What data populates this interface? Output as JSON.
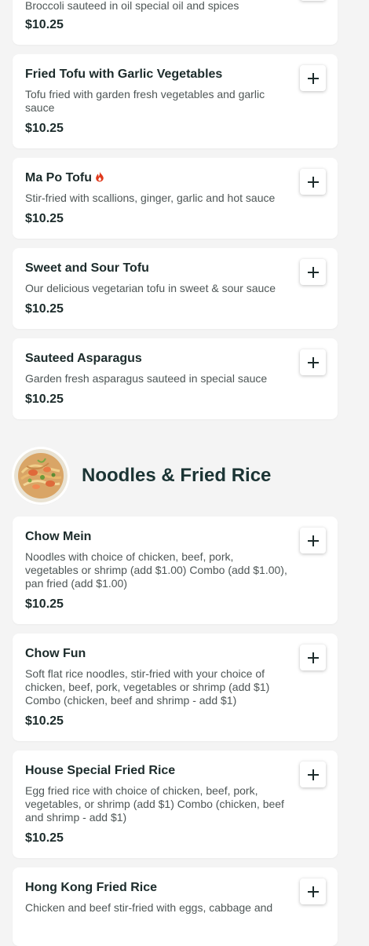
{
  "colors": {
    "background": "#f4f4f4",
    "card": "#ffffff",
    "title_text": "#1c2b2b",
    "desc_text": "#4e5656",
    "spicy": "#e0391c"
  },
  "partial_item": {
    "desc": "Broccoli sauteed in oil special oil and spices",
    "price": "$10.25"
  },
  "items_top": [
    {
      "name": "Fried Tofu with Garlic Vegetables",
      "desc": "Tofu fried with garden fresh vegetables and garlic sauce",
      "price": "$10.25",
      "spicy": false
    },
    {
      "name": "Ma Po Tofu",
      "desc": "Stir-fried with scallions, ginger, garlic and hot sauce",
      "price": "$10.25",
      "spicy": true
    },
    {
      "name": "Sweet and Sour Tofu",
      "desc": "Our delicious vegetarian tofu in sweet & sour sauce",
      "price": "$10.25",
      "spicy": false
    },
    {
      "name": "Sauteed Asparagus",
      "desc": "Garden fresh asparagus sauteed in special sauce",
      "price": "$10.25",
      "spicy": false
    }
  ],
  "section": {
    "title": "Noodles & Fried Rice",
    "image_icon": "noodle-dish-photo"
  },
  "items_section": [
    {
      "name": "Chow Mein",
      "desc": "Noodles with choice of chicken, beef, pork, vegetables or shrimp (add $1.00) Combo (add $1.00), pan fried (add $1.00)",
      "price": "$10.25"
    },
    {
      "name": "Chow Fun",
      "desc": "Soft flat rice noodles, stir-fried with your choice of chicken, beef, pork, vegetables or shrimp (add $1) Combo (chicken, beef and shrimp - add $1)",
      "price": "$10.25"
    },
    {
      "name": "House Special Fried Rice",
      "desc": "Egg fried rice with choice of chicken, beef, pork, vegetables, or shrimp (add $1) Combo (chicken, beef and shrimp - add $1)",
      "price": "$10.25"
    },
    {
      "name": "Hong Kong Fried Rice",
      "desc": "Chicken and beef stir-fried with eggs, cabbage and",
      "price": ""
    }
  ],
  "icons": {
    "add": "plus-icon",
    "spicy": "flame-icon"
  }
}
